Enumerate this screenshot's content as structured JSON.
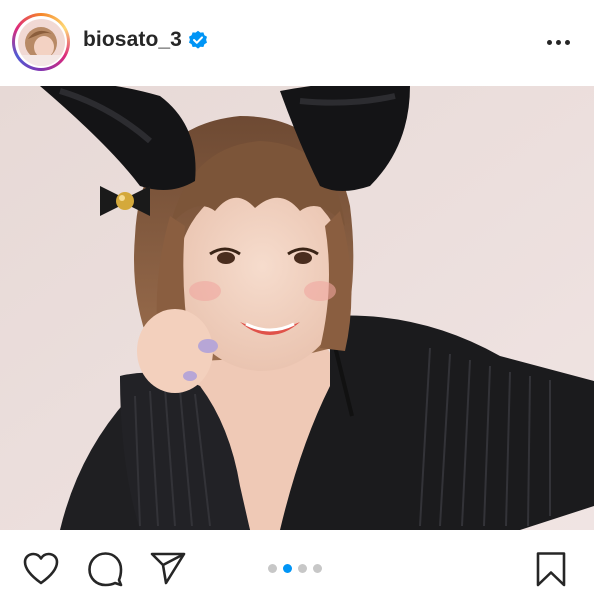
{
  "header": {
    "username": "biosato_3",
    "verified": true,
    "avatar_icon": "profile-avatar",
    "more_icon": "more-options-icon"
  },
  "photo": {
    "subject": "selfie-with-cat-ears"
  },
  "actions": {
    "like_icon": "heart-icon",
    "comment_icon": "comment-bubble-icon",
    "share_icon": "paper-plane-icon",
    "save_icon": "bookmark-icon"
  },
  "carousel": {
    "total": 4,
    "active_index": 1
  },
  "colors": {
    "accent": "#0095f6",
    "verified_blue": "#0095f6",
    "text": "#262626",
    "inactive_dot": "#c7c7c7"
  }
}
